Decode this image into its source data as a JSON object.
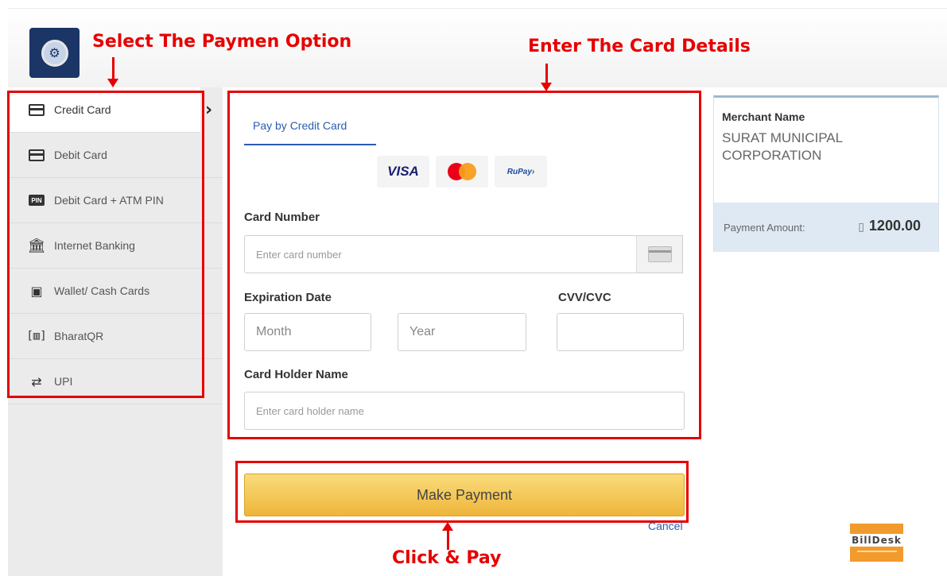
{
  "annotations": {
    "select_payment": "Select The Paymen Option",
    "enter_card": "Enter The Card Details",
    "click_pay": "Click & Pay"
  },
  "sidebar": {
    "items": [
      {
        "label": "Credit Card",
        "icon": "credit-card-icon",
        "active": true
      },
      {
        "label": "Debit Card",
        "icon": "debit-card-icon"
      },
      {
        "label": "Debit Card + ATM PIN",
        "icon": "pin-icon",
        "icon_text": "PIN"
      },
      {
        "label": "Internet Banking",
        "icon": "bank-icon"
      },
      {
        "label": "Wallet/ Cash Cards",
        "icon": "wallet-icon"
      },
      {
        "label": "BharatQR",
        "icon": "qr-icon"
      },
      {
        "label": "UPI",
        "icon": "upi-icon"
      }
    ]
  },
  "form": {
    "tab_label": "Pay by Credit Card",
    "brands": {
      "visa": "VISA",
      "mastercard": "mastercard-logo",
      "rupay": "RuPay›"
    },
    "card_number_label": "Card Number",
    "card_number_placeholder": "Enter card number",
    "expiry_label": "Expiration Date",
    "month_placeholder": "Month",
    "year_placeholder": "Year",
    "cvv_label": "CVV/CVC",
    "holder_label": "Card Holder Name",
    "holder_placeholder": "Enter card holder name",
    "submit_label": "Make Payment",
    "cancel_label": "Cancel"
  },
  "merchant": {
    "heading": "Merchant Name",
    "name": "SURAT MUNICIPAL CORPORATION",
    "amount_label": "Payment Amount:",
    "currency_symbol": "▯",
    "amount": "1200.00"
  },
  "footer": {
    "logo_text": "BillDesk"
  },
  "colors": {
    "accent": "#2a5db0",
    "annotation": "#e60000",
    "button": "#efb53a",
    "billdesk": "#f39a2d"
  }
}
